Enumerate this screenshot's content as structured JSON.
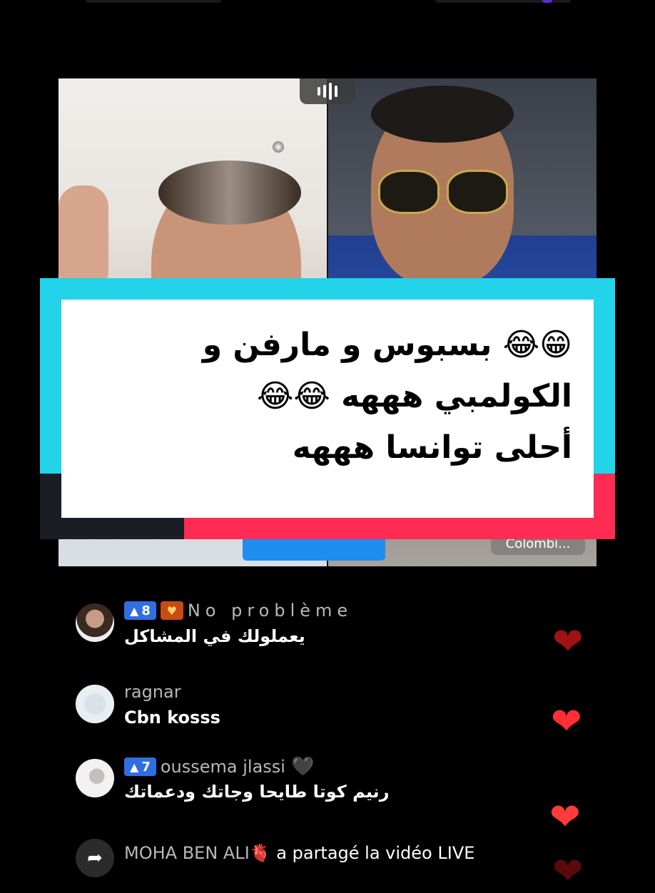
{
  "caption": {
    "line1": "😁😂 بسبوس و مارفن و",
    "line2": "الكولمبي هههه 😂😂",
    "line3": "أحلى توانسا هههه"
  },
  "video": {
    "right_chip_label": "Colombi..."
  },
  "comments": [
    {
      "level": "8",
      "fan_badge": "♥",
      "username": "No problème",
      "message": "يعملولك في المشاكل",
      "avatar": "avatar-woman"
    },
    {
      "username": "ragnar",
      "message": "Cbn kosss",
      "avatar": "avatar-default"
    },
    {
      "level": "7",
      "username": "oussema jlassi",
      "suffix": "🖤",
      "message": "رنيم كوتا طايحا وجاتك ودعماتك",
      "avatar": "avatar-photo"
    }
  ],
  "share_event": {
    "username": "MOHA BEN ALI🫀",
    "text": " a partagé la vidéo LIVE",
    "icon": "share-arrow-icon"
  },
  "colors": {
    "caption_cyan": "#22d3ea",
    "caption_red": "#ff2b52",
    "level_badge": "#2f6fe0",
    "heart": "#ff2d34"
  }
}
